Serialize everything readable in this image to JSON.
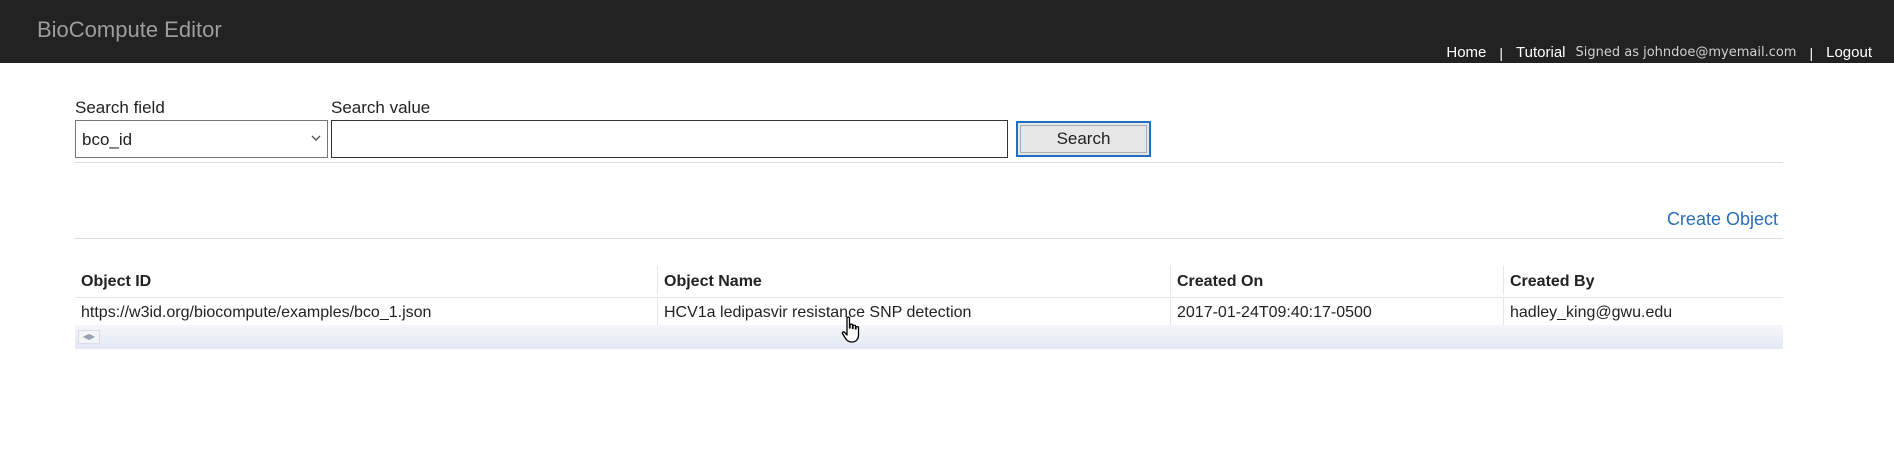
{
  "navbar": {
    "brand": "BioCompute Editor",
    "links": {
      "home": "Home",
      "tutorial": "Tutorial",
      "signed": "Signed as johndoe@myemail.com",
      "logout": "Logout",
      "sep": "|"
    }
  },
  "search": {
    "field_label": "Search field",
    "field_value": "bco_id",
    "value_label": "Search value",
    "value": "",
    "button": "Search"
  },
  "actions": {
    "create": "Create Object"
  },
  "table": {
    "columns": [
      "Object ID",
      "Object Name",
      "Created On",
      "Created By"
    ],
    "rows": [
      [
        "https://w3id.org/biocompute/examples/bco_1.json",
        "HCV1a ledipasvir resistance SNP detection",
        "2017-01-24T09:40:17-0500",
        "hadley_king@gwu.edu"
      ]
    ]
  },
  "icons": {
    "select": "chevron-down-icon",
    "cursor": "hand-pointer-icon",
    "scroll": "scroll-arrows-icon"
  },
  "colors": {
    "navbar": "#222222",
    "brand": "#9d9d9d",
    "link": "#2a6ebb",
    "button_border": "#1f6fc5"
  }
}
